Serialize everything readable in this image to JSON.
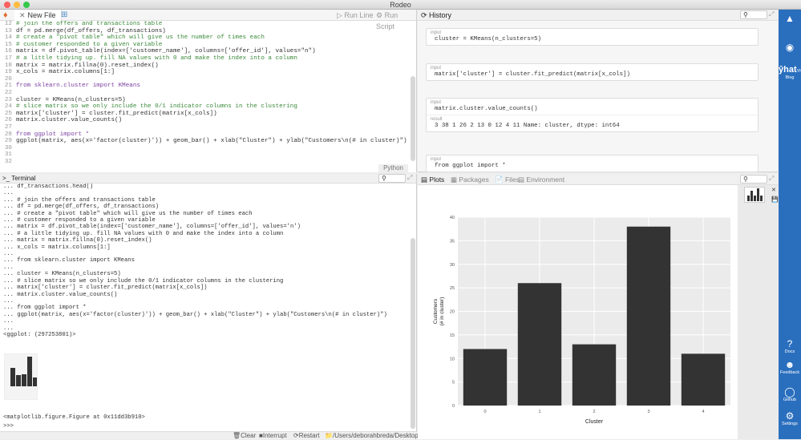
{
  "window": {
    "title": "Rodeo"
  },
  "editor": {
    "tab_label": "New File",
    "run_line": "Run Line",
    "run_script": "Run Script",
    "mode": "Python",
    "lines": [
      {
        "n": "12",
        "text": "# join the offers and transactions table"
      },
      {
        "n": "13",
        "text": "df = pd.merge(df_offers, df_transactions)"
      },
      {
        "n": "14",
        "text": "# create a \"pivot table\" which will give us the number of times each"
      },
      {
        "n": "15",
        "text": "# customer responded to a given variable"
      },
      {
        "n": "16",
        "text": "matrix = df.pivot_table(index=['customer_name'], columns=['offer_id'], values=\"n\")"
      },
      {
        "n": "17",
        "text": "# a little tidying up. fill NA values with 0 and make the index into a column"
      },
      {
        "n": "18",
        "text": "matrix = matrix.fillna(0).reset_index()"
      },
      {
        "n": "19",
        "text": "x_cols = matrix.columns[1:]"
      },
      {
        "n": "20",
        "text": ""
      },
      {
        "n": "21",
        "text": "from sklearn.cluster import KMeans"
      },
      {
        "n": "22",
        "text": ""
      },
      {
        "n": "23",
        "text": "cluster = KMeans(n_clusters=5)"
      },
      {
        "n": "24",
        "text": "# slice matrix so we only include the 0/1 indicator columns in the clustering"
      },
      {
        "n": "25",
        "text": "matrix['cluster'] = cluster.fit_predict(matrix[x_cols])"
      },
      {
        "n": "26",
        "text": "matrix.cluster.value_counts()"
      },
      {
        "n": "27",
        "text": ""
      },
      {
        "n": "28",
        "text": "from ggplot import *"
      },
      {
        "n": "29",
        "text": "ggplot(matrix, aes(x='factor(cluster)')) + geom_bar() + xlab(\"Cluster\") + ylab(\"Customers\\n(# in cluster)\")"
      },
      {
        "n": "30",
        "text": ""
      },
      {
        "n": "31",
        "text": ""
      },
      {
        "n": "32",
        "text": ""
      }
    ]
  },
  "terminal": {
    "tab_label": "Terminal",
    "lines": [
      "... df_transactions.head()",
      "...",
      "... # join the offers and transactions table",
      "... df = pd.merge(df_offers, df_transactions)",
      "... # create a \"pivot table\" which will give us the number of times each",
      "... # customer responded to a given variable",
      "... matrix = df.pivot_table(index=['customer_name'], columns=['offer_id'], values='n')",
      "... # a little tidying up. fill NA values with 0 and make the index into a column",
      "... matrix = matrix.fillna(0).reset_index()",
      "... x_cols = matrix.columns[1:]",
      "...",
      "... from sklearn.cluster import KMeans",
      "...",
      "... cluster = KMeans(n_clusters=5)",
      "... # slice matrix so we only include the 0/1 indicator columns in the clustering",
      "... matrix['cluster'] = cluster.fit_predict(matrix[x_cols])",
      "... matrix.cluster.value_counts()",
      "...",
      "... from ggplot import *",
      "... ggplot(matrix, aes(x='factor(cluster)')) + geom_bar() + xlab(\"Cluster\") + ylab(\"Customers\\n(# in cluster)\")",
      "...",
      "...",
      "<ggplot: (297253801)>"
    ],
    "figure_line": "<matplotlib.figure.Figure at 0x11dd3b910>",
    "prompt": ">>>",
    "clear": "Clear",
    "interrupt": "Interrupt",
    "restart": "Restart",
    "cwd": "/Users/deborahbreda/Desktop"
  },
  "history": {
    "tab_label": "History",
    "cards": [
      {
        "label": "input",
        "code": "cluster = KMeans(n_clusters=5)"
      },
      {
        "label": "input",
        "code": "matrix['cluster'] = cluster.fit_predict(matrix[x_cols])"
      },
      {
        "label": "input",
        "code": "matrix.cluster.value_counts()",
        "result_label": "result",
        "result": "3 38 1 26 2 13 0 12 4 11 Name: cluster, dtype: int64"
      },
      {
        "label": "input",
        "code": "from ggplot import *"
      }
    ]
  },
  "plots": {
    "tabs": [
      "Plots",
      "Packages",
      "Files",
      "Environment"
    ]
  },
  "chart_data": {
    "type": "bar",
    "categories": [
      "0",
      "1",
      "2",
      "3",
      "4"
    ],
    "values": [
      12,
      26,
      13,
      38,
      11
    ],
    "xlabel": "Cluster",
    "ylabel": "Customers\n(# in cluster)",
    "ylim": [
      0,
      40
    ],
    "yticks": [
      0,
      5,
      10,
      15,
      20,
      25,
      30,
      35,
      40
    ],
    "bar_color": "#333333",
    "background": "#ebebeb",
    "grid": true
  },
  "sidebar": {
    "items": [
      "Yhat Blog",
      "Docs",
      "Feedback",
      "Github",
      "Settings"
    ]
  },
  "colors": {
    "accent": "#2a6fbe",
    "orange": "#e26b2c"
  }
}
